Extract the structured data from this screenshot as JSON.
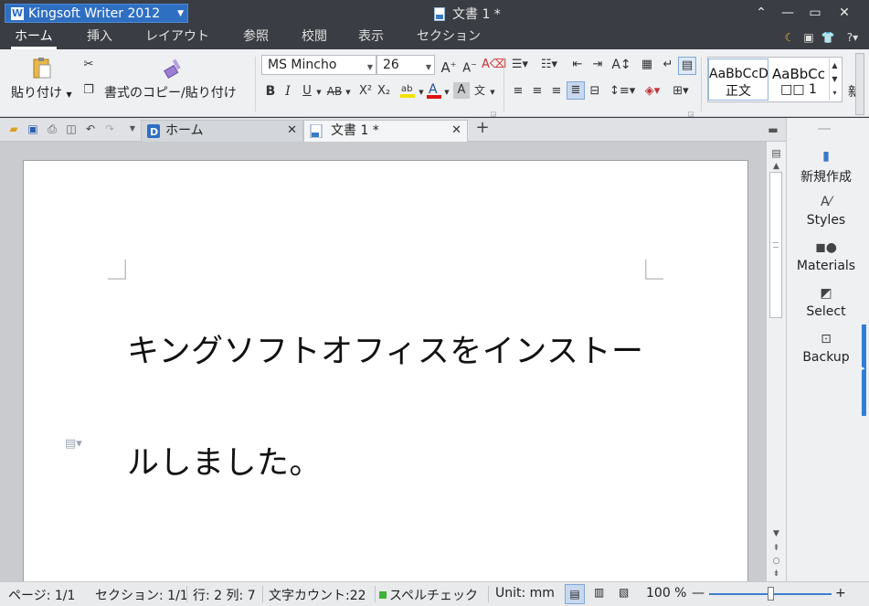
{
  "titlebar": {
    "app_name": "Kingsoft Writer 2012",
    "document_title": "文書 1 *",
    "min_glyph": "⌃",
    "minimize": "—",
    "maximize": "▭",
    "close": "✕"
  },
  "menu": {
    "tabs": [
      "ホーム",
      "挿入",
      "レイアウト",
      "参照",
      "校閲",
      "表示",
      "セクション"
    ],
    "active_tab": "ホーム",
    "help": "?"
  },
  "ribbon": {
    "paste_label": "貼り付け",
    "format_copy_label": "書式のコピー/貼り付け",
    "font_name": "MS Mincho",
    "font_size": "26",
    "bold": "B",
    "italic": "I",
    "underline": "U",
    "strike": "AB",
    "superscript": "X²",
    "subscript": "X₂",
    "styles": [
      {
        "preview": "AaBbCcD",
        "name": "正文"
      },
      {
        "preview": "AaBbCc",
        "name": "□□ 1"
      }
    ],
    "new_style_label": "新"
  },
  "quick_access": {
    "tabs": [
      {
        "label": "ホーム",
        "active": false
      },
      {
        "label": "文書 1 *",
        "active": true
      }
    ],
    "new_tab": "+"
  },
  "document": {
    "lines": [
      "キングソフトオフィスをインストー",
      "ルしました。"
    ]
  },
  "right_panel": {
    "items": [
      {
        "label": "新規作成",
        "icon": "new-doc-icon"
      },
      {
        "label": "Styles",
        "icon": "styles-icon"
      },
      {
        "label": "Materials",
        "icon": "materials-icon"
      },
      {
        "label": "Select",
        "icon": "select-icon"
      },
      {
        "label": "Backup",
        "icon": "backup-icon"
      }
    ]
  },
  "statusbar": {
    "page": "ページ: 1/1",
    "section": "セクション: 1/1",
    "position": "行: 2 列: 7",
    "word_count": "文字カウント:22",
    "spellcheck": "スペルチェック",
    "unit": "Unit: mm",
    "zoom": "100 %",
    "zoom_level": 1.0
  },
  "colors": {
    "titlebar_bg": "#3a3d43",
    "accent": "#2f6fc2",
    "ribbon_bg": "#eff0f2"
  }
}
